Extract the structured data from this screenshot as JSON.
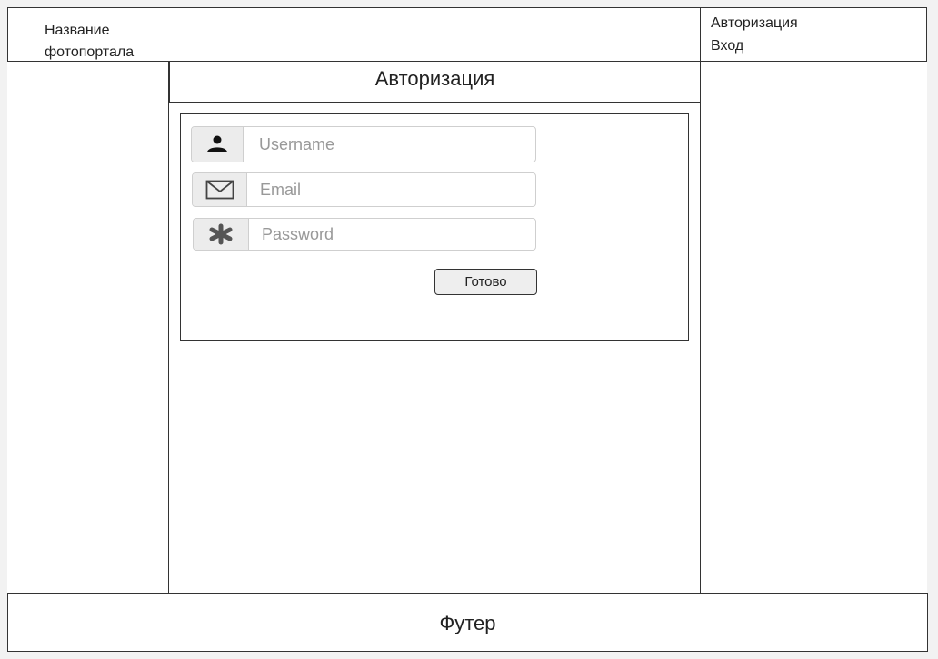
{
  "header": {
    "site_name_line1": "Название",
    "site_name_line2": "фотопортала",
    "auth_link": "Авторизация",
    "login_link": "Вход"
  },
  "main": {
    "title": "Авторизация",
    "form": {
      "username": {
        "placeholder": "Username",
        "value": "",
        "icon": "user-icon"
      },
      "email": {
        "placeholder": "Email",
        "value": "",
        "icon": "envelope-icon"
      },
      "password": {
        "placeholder": "Password",
        "value": "",
        "icon": "asterisk-icon"
      },
      "submit_label": "Готово"
    }
  },
  "footer": {
    "label": "Футер"
  }
}
